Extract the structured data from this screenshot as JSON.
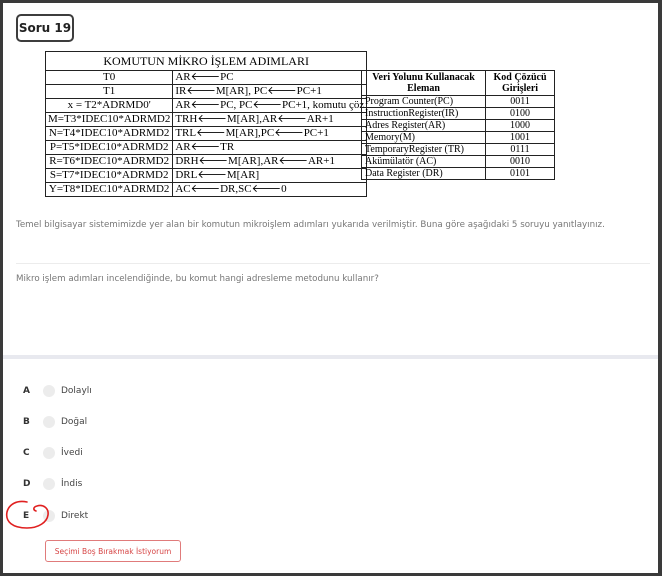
{
  "question": {
    "number_label": "Soru 19",
    "intro": "Temel bilgisayar sistemimizde yer alan bir komutun mikroişlem adımları yukarıda verilmiştir. Buna göre aşağıdaki 5 soruyu yanıtlayınız.",
    "text": "Mikro işlem adımları incelendiğinde, bu komut hangi adresleme metodunu kullanır?"
  },
  "micro_table": {
    "title": "KOMUTUN MİKRO İŞLEM ADIMLARI",
    "rows": [
      {
        "cond": "T0",
        "op": "AR🡐PC"
      },
      {
        "cond": "T1",
        "op": "IR🡐M[AR], PC🡐PC+1"
      },
      {
        "cond": "x = T2*ADRMD0'",
        "op": "AR🡐PC, PC🡐PC+1, komutu çöz"
      },
      {
        "cond": "M=T3*IDEC10*ADRMD2",
        "op": "TRH🡐M[AR],AR🡐AR+1"
      },
      {
        "cond": "N=T4*IDEC10*ADRMD2",
        "op": "TRL🡐M[AR],PC🡐PC+1"
      },
      {
        "cond": "P=T5*IDEC10*ADRMD2",
        "op": "AR🡐TR"
      },
      {
        "cond": "R=T6*IDEC10*ADRMD2",
        "op": "DRH🡐M[AR],AR🡐AR+1"
      },
      {
        "cond": "S=T7*IDEC10*ADRMD2",
        "op": "DRL🡐M[AR]"
      },
      {
        "cond": "Y=T8*IDEC10*ADRMD2",
        "op": "AC🡐DR,SC🡐0"
      }
    ]
  },
  "codes_table": {
    "header_col1": "Veri Yolunu Kullanacak Eleman",
    "header_col2": "Kod Çözücü Girişleri",
    "rows": [
      {
        "element": "Program Counter(PC)",
        "code": "0011"
      },
      {
        "element": "InstructionRegister(IR)",
        "code": "0100"
      },
      {
        "element": "Adres Register(AR)",
        "code": "1000"
      },
      {
        "element": "Memory(M)",
        "code": "1001"
      },
      {
        "element": "TemporaryRegister (TR)",
        "code": "0111"
      },
      {
        "element": "Akümülatör (AC)",
        "code": "0010"
      },
      {
        "element": "Data Register (DR)",
        "code": "0101"
      }
    ]
  },
  "options": [
    {
      "letter": "A",
      "label": "Dolaylı"
    },
    {
      "letter": "B",
      "label": "Doğal"
    },
    {
      "letter": "C",
      "label": "İvedi"
    },
    {
      "letter": "D",
      "label": "İndis"
    },
    {
      "letter": "E",
      "label": "Direkt"
    }
  ],
  "clear_button": "Seçimi Boş Bırakmak İstiyorum",
  "colors": {
    "accent_red": "#d64545",
    "annotation_red": "#e02020",
    "text_muted": "#777777",
    "separator": "#e8e9ef"
  }
}
